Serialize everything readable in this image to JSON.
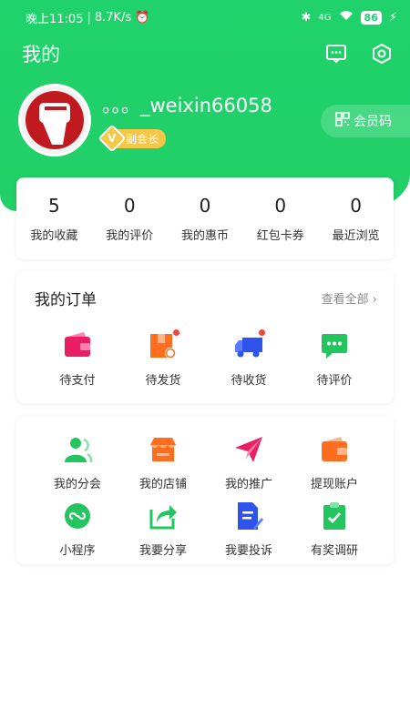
{
  "status_bar": {
    "time": "晚上11:05",
    "speed": "8.7K/s",
    "signal": "4G",
    "battery": "86"
  },
  "header": {
    "title": "我的"
  },
  "profile": {
    "username": "。。。_weixin66058",
    "level": "副会长",
    "level_icon_letter": "V",
    "member_code_label": "会员码"
  },
  "stats": [
    {
      "value": "5",
      "label": "我的收藏"
    },
    {
      "value": "0",
      "label": "我的评价"
    },
    {
      "value": "0",
      "label": "我的惠币"
    },
    {
      "value": "0",
      "label": "红包卡券"
    },
    {
      "value": "0",
      "label": "最近浏览"
    }
  ],
  "orders": {
    "title": "我的订单",
    "view_all": "查看全部",
    "items": [
      {
        "label": "待支付",
        "icon": "wallet-icon",
        "color": "#e91e63"
      },
      {
        "label": "待发货",
        "icon": "shipping-box-icon",
        "color": "#ff6d1f"
      },
      {
        "label": "待收货",
        "icon": "delivery-truck-icon",
        "color": "#2f54eb"
      },
      {
        "label": "待评价",
        "icon": "comment-icon",
        "color": "#22c55e"
      }
    ]
  },
  "services": {
    "items": [
      {
        "label": "我的分会",
        "icon": "users-icon",
        "color": "#22c55e"
      },
      {
        "label": "我的店铺",
        "icon": "store-icon",
        "color": "#ff6d1f"
      },
      {
        "label": "我的推广",
        "icon": "paper-plane-icon",
        "color": "#e91e63"
      },
      {
        "label": "提现账户",
        "icon": "wallet-icon",
        "color": "#ff6d1f"
      },
      {
        "label": "小程序",
        "icon": "mini-program-icon",
        "color": "#22c55e"
      },
      {
        "label": "我要分享",
        "icon": "share-icon",
        "color": "#22c55e"
      },
      {
        "label": "我要投诉",
        "icon": "complaint-icon",
        "color": "#2f54eb"
      },
      {
        "label": "有奖调研",
        "icon": "survey-icon",
        "color": "#22c55e"
      }
    ]
  }
}
